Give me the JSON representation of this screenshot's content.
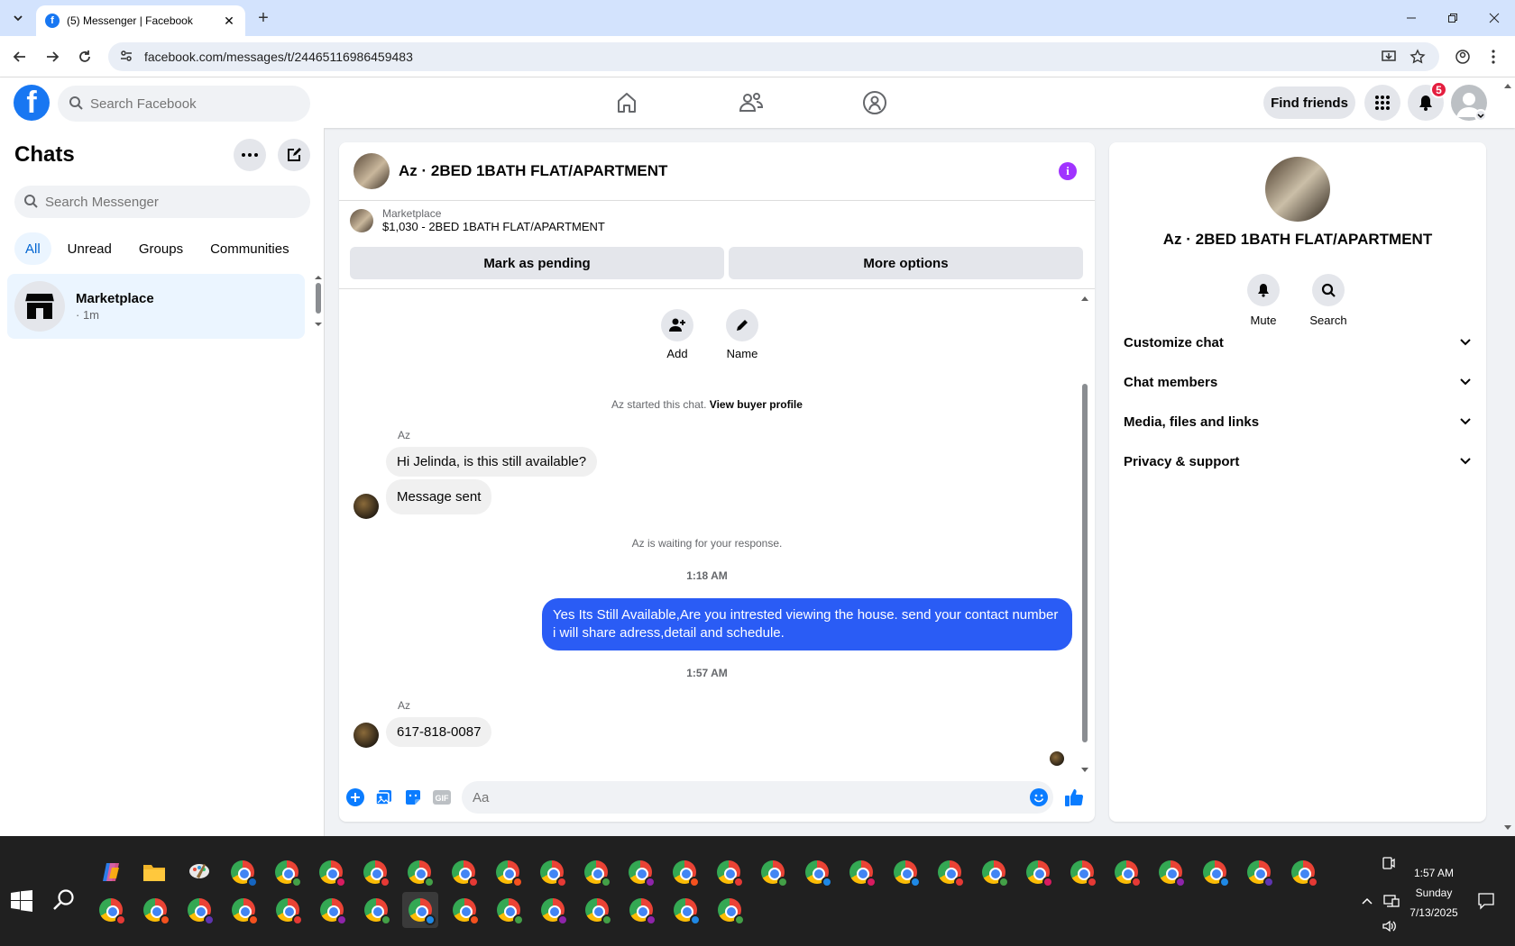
{
  "browser": {
    "tab_title": "(5) Messenger | Facebook",
    "url": "facebook.com/messages/t/24465116986459483"
  },
  "header": {
    "search_placeholder": "Search Facebook",
    "find_friends": "Find friends",
    "notification_count": "5",
    "brand_color": "#1877f2"
  },
  "sidebar": {
    "title": "Chats",
    "search_placeholder": "Search Messenger",
    "filters": [
      "All",
      "Unread",
      "Groups",
      "Communities"
    ],
    "chats": [
      {
        "name": "Marketplace",
        "time": "· 1m"
      }
    ]
  },
  "conversation": {
    "title": "Az · 2BED 1BATH FLAT/APARTMENT",
    "marketplace_label": "Marketplace",
    "listing": "$1,030 - 2BED 1BATH FLAT/APARTMENT",
    "mark_pending": "Mark as pending",
    "more_options": "More options",
    "quick_actions": [
      "Add",
      "Name"
    ],
    "started_text": "Az started this chat.",
    "view_profile": "View buyer profile",
    "sender_name": "Az",
    "incoming_1": "Hi Jelinda, is this still available?",
    "incoming_2": "Message sent",
    "waiting_text": "Az is waiting for your response.",
    "time_1": "1:18 AM",
    "outgoing": "Yes Its Still Available,Are you intrested viewing the house. send your contact number i will share adress,detail and schedule.",
    "time_2": "1:57 AM",
    "incoming_3": "617-818-0087",
    "composer_placeholder": "Aa",
    "outgoing_color": "#2a5cf5",
    "accent_color": "#a033ff"
  },
  "details": {
    "name": "Az · 2BED 1BATH FLAT/APARTMENT",
    "actions": [
      "Mute",
      "Search"
    ],
    "sections": [
      "Customize chat",
      "Chat members",
      "Media, files and links",
      "Privacy & support"
    ]
  },
  "taskbar": {
    "time": "1:57 AM",
    "day": "Sunday",
    "date": "7/13/2025"
  }
}
